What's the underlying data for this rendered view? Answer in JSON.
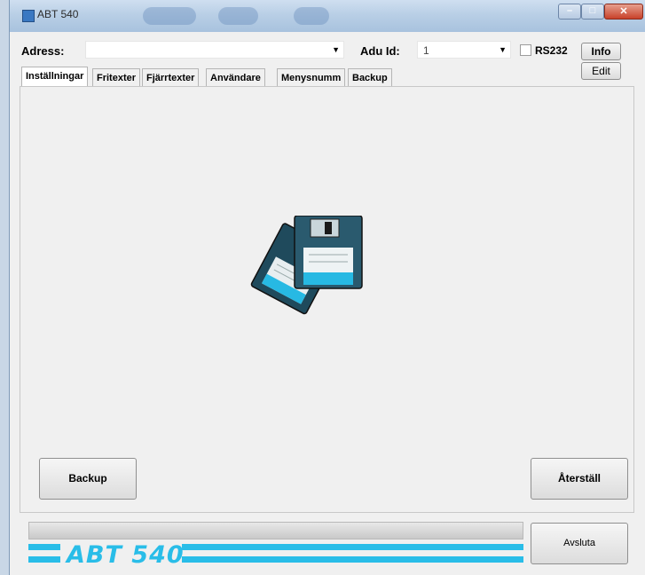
{
  "window": {
    "title": "ABT 540"
  },
  "toolbar": {
    "address_label": "Adress:",
    "address_value": "",
    "adu_label": "Adu Id:",
    "adu_value": "1",
    "rs232_label": "RS232",
    "rs232_checked": false,
    "info_label": "Info",
    "edit_label": "Edit"
  },
  "tabs": [
    {
      "label": "Inställningar",
      "active": true
    },
    {
      "label": "Fritexter",
      "active": false
    },
    {
      "label": "Fjärrtexter",
      "active": false
    },
    {
      "label": "Användare",
      "active": false
    },
    {
      "label": "Menysnumm",
      "active": false
    },
    {
      "label": "Backup",
      "active": false
    }
  ],
  "panel": {
    "backup_button": "Backup",
    "reset_button": "Återställ"
  },
  "footer": {
    "logo_text": "ABT 540",
    "exit_button": "Avsluta",
    "progress": 0
  },
  "colors": {
    "accent": "#29bde8",
    "floppy_body": "#2a5a6e"
  },
  "icons": [
    "floppy-disks-icon"
  ]
}
